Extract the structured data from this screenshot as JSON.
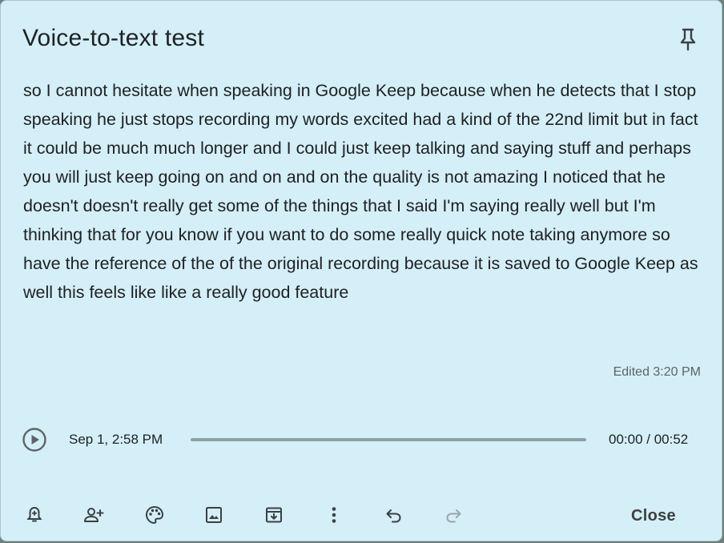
{
  "note": {
    "title": "Voice-to-text test",
    "body": "so I cannot hesitate when speaking in Google Keep because when he detects that I stop speaking he just stops recording my words excited had a kind of the 22nd limit but in fact it could be much much longer and I could just keep talking and saying stuff and perhaps you will just keep going on and on and on the quality is not amazing I noticed that he doesn't doesn't really get some of the things that I said I'm saying really well but I'm thinking that for you know if you want to do some really quick note taking anymore so have the reference of the of the original recording because it is saved to Google Keep as well this feels like like a really good feature",
    "edited": "Edited 3:20 PM",
    "background_color": "#d4eff7"
  },
  "audio": {
    "date": "Sep 1, 2:58 PM",
    "time": "00:00 / 00:52",
    "progress": 0
  },
  "toolbar": {
    "icons": [
      "reminder-bell-icon",
      "collaborator-icon",
      "palette-icon",
      "image-icon",
      "archive-icon",
      "more-vert-icon",
      "undo-icon",
      "redo-icon"
    ],
    "close_label": "Close"
  }
}
